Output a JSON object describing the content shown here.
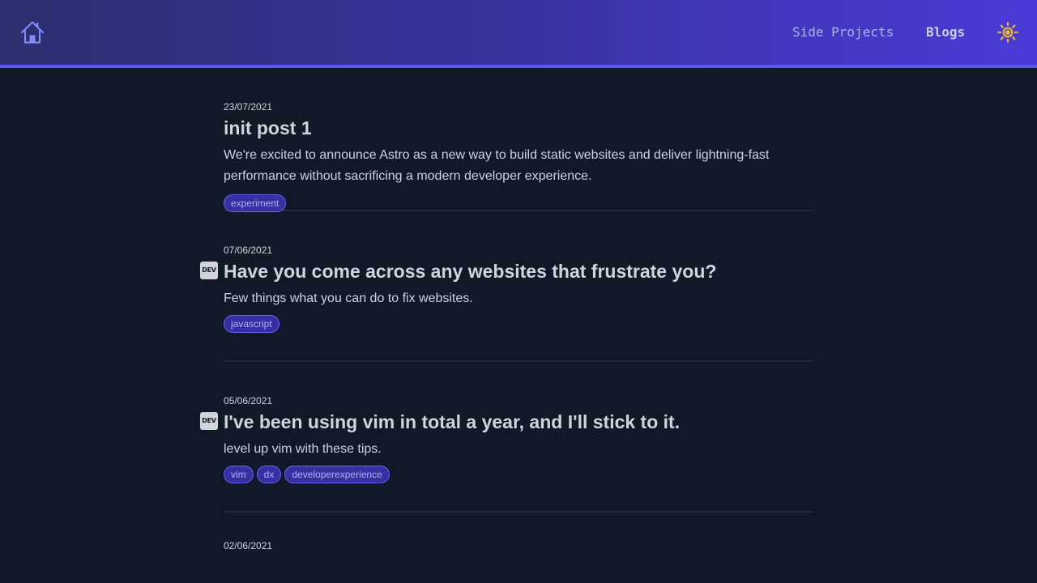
{
  "nav": {
    "home_icon": "home-icon",
    "links": [
      {
        "label": "Side Projects"
      },
      {
        "label": "Blogs"
      }
    ],
    "theme_icon": "sun-icon"
  },
  "colors": {
    "background": "#111827",
    "nav_gradient_start": "#2b2f6e",
    "nav_gradient_end": "#4a3ad8",
    "accent": "#6366f1",
    "sun": "#e2b33a"
  },
  "posts": [
    {
      "date": "23/07/2021",
      "title": "init post 1",
      "description": "We're excited to announce Astro as a new way to build static websites and deliver lightning-fast performance without sacrificing a modern developer experience.",
      "tags": [
        "experiment"
      ],
      "badge": ""
    },
    {
      "date": "07/06/2021",
      "title": "Have you come across any websites that frustrate you?",
      "description": "Few things what you can do to fix websites.",
      "tags": [
        "javascript"
      ],
      "badge": "DEV"
    },
    {
      "date": "05/06/2021",
      "title": "I've been using vim in total a year, and I'll stick to it.",
      "description": "level up vim with these tips.",
      "tags": [
        "vim",
        "dx",
        "developerexperience"
      ],
      "badge": "DEV"
    },
    {
      "date": "02/06/2021",
      "title": "",
      "description": "",
      "tags": [],
      "badge": ""
    }
  ]
}
